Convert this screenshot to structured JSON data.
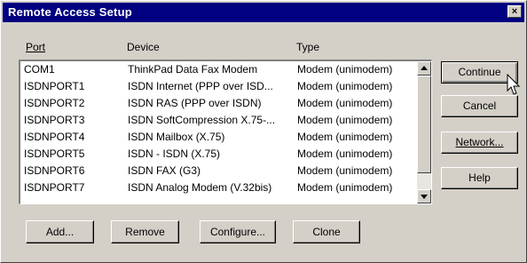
{
  "window": {
    "title": "Remote Access Setup",
    "close_label": "×"
  },
  "columns": {
    "port": "Port",
    "device": "Device",
    "type": "Type"
  },
  "rows": [
    {
      "port": "COM1",
      "device": "ThinkPad Data Fax Modem",
      "type": "Modem (unimodem)"
    },
    {
      "port": "ISDNPORT1",
      "device": "ISDN Internet (PPP over ISD...",
      "type": "Modem (unimodem)"
    },
    {
      "port": "ISDNPORT2",
      "device": "ISDN RAS (PPP over ISDN)",
      "type": "Modem (unimodem)"
    },
    {
      "port": "ISDNPORT3",
      "device": "ISDN SoftCompression X.75-...",
      "type": "Modem (unimodem)"
    },
    {
      "port": "ISDNPORT4",
      "device": "ISDN Mailbox (X.75)",
      "type": "Modem (unimodem)"
    },
    {
      "port": "ISDNPORT5",
      "device": "ISDN - ISDN (X.75)",
      "type": "Modem (unimodem)"
    },
    {
      "port": "ISDNPORT6",
      "device": "ISDN FAX (G3)",
      "type": "Modem (unimodem)"
    },
    {
      "port": "ISDNPORT7",
      "device": "ISDN Analog Modem (V.32bis)",
      "type": "Modem (unimodem)"
    }
  ],
  "buttons": {
    "continue": "Continue",
    "cancel": "Cancel",
    "network": "Network...",
    "help": "Help",
    "add": "Add...",
    "remove": "Remove",
    "configure": "Configure...",
    "clone": "Clone"
  }
}
